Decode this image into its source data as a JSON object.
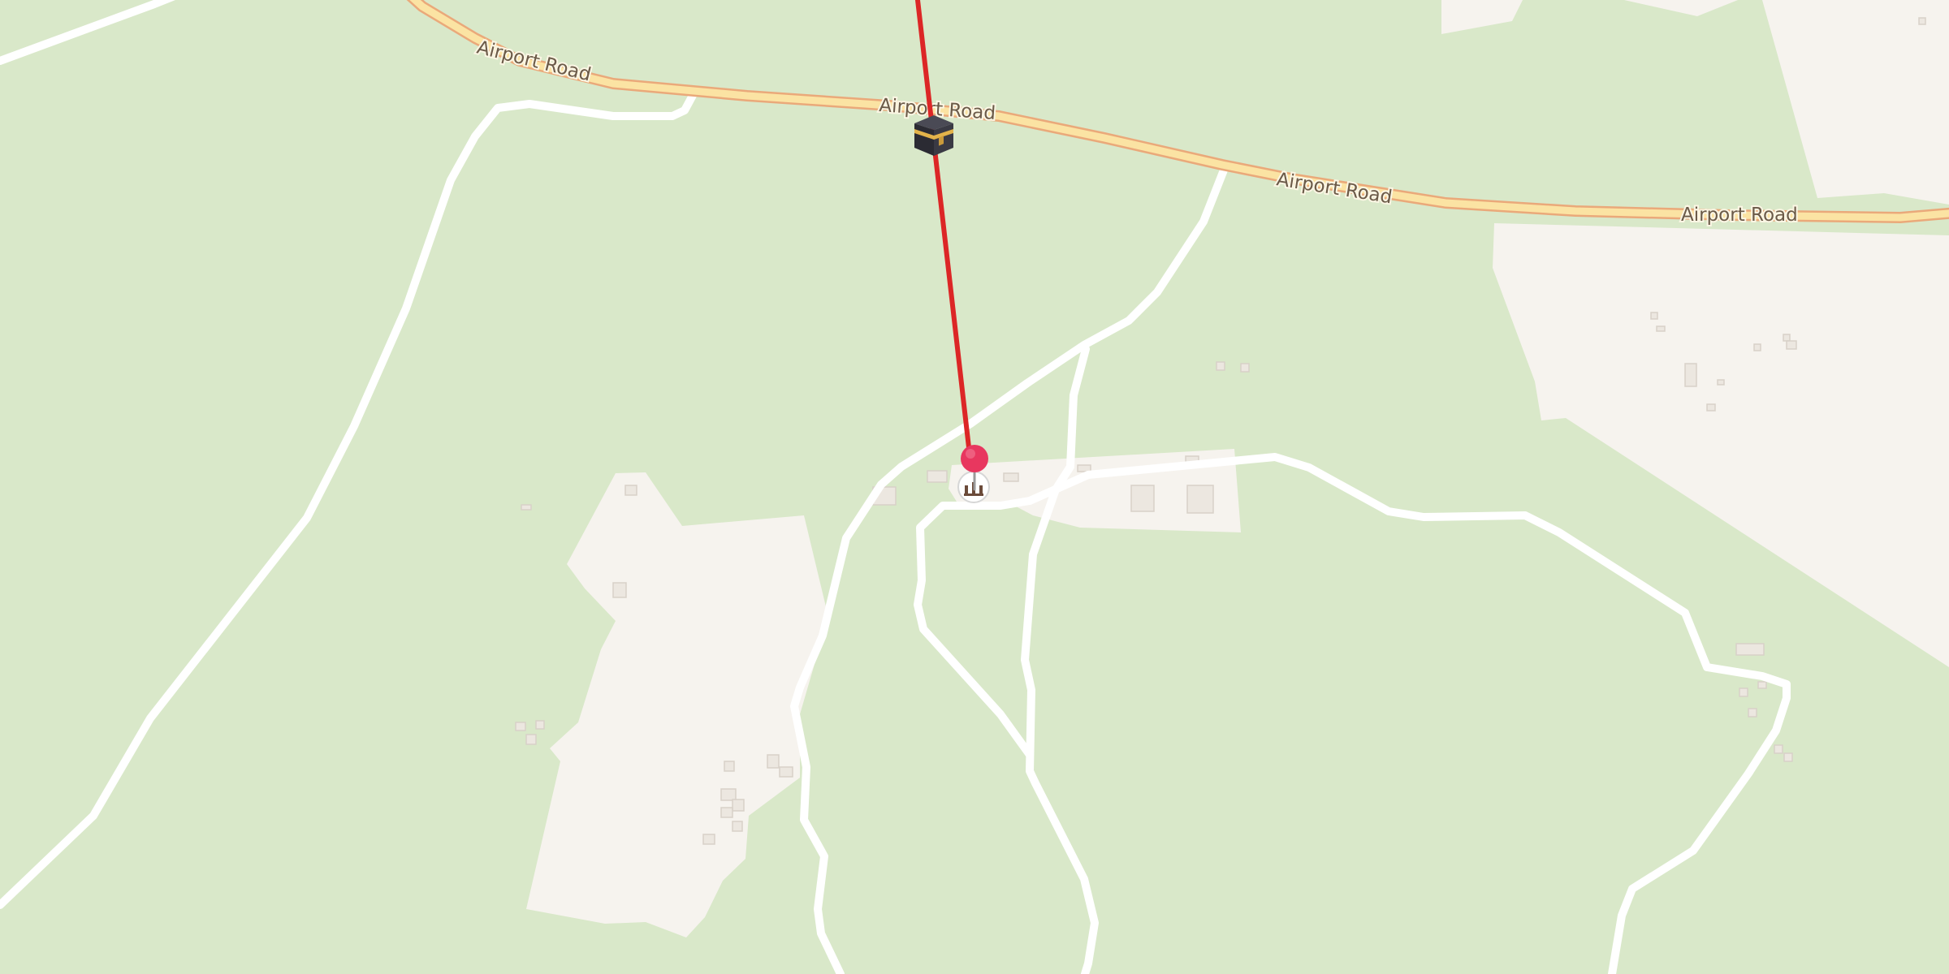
{
  "map": {
    "road_labels": [
      "Airport Road",
      "Airport Road",
      "Airport Road",
      "Airport Road"
    ],
    "markers": {
      "kaaba": {
        "icon": "kaaba-icon"
      },
      "location_pin": {
        "icon": "map-pin-icon",
        "color": "#e8375f"
      },
      "poi": {
        "icon": "mosque-icon"
      }
    },
    "colors": {
      "land": "#d9e8c9",
      "residential": "#f6f3ee",
      "main_road": "#fbe3a3",
      "main_road_casing": "#eaa97a",
      "minor_road": "#ffffff",
      "qibla_line": "#dc2626",
      "building": "#ece7e0"
    }
  }
}
